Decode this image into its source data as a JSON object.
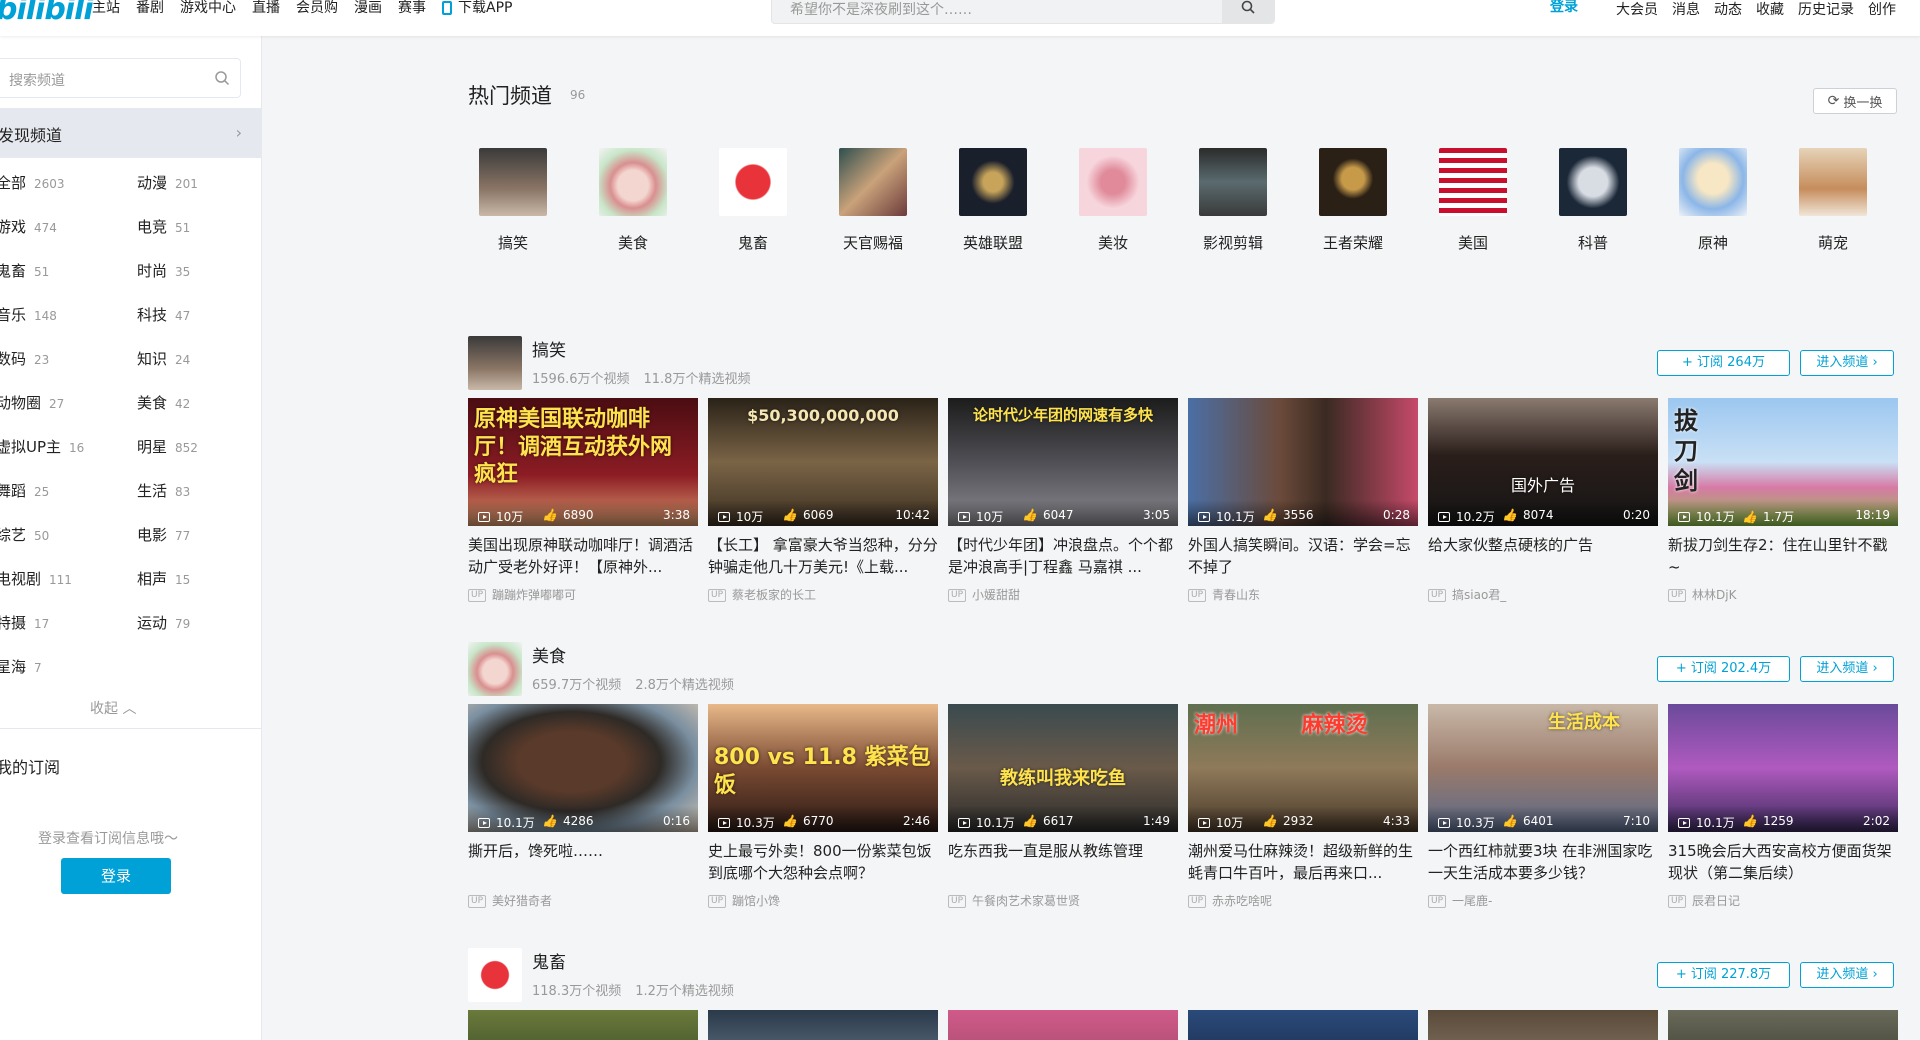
{
  "topbar": {
    "logo": "bilibili",
    "nav": [
      "主站",
      "番剧",
      "游戏中心",
      "直播",
      "会员购",
      "漫画",
      "赛事",
      "下载APP"
    ],
    "search_placeholder": "希望你不是深夜刷到这个……",
    "login": "登录",
    "right_nav": [
      "大会员",
      "消息",
      "动态",
      "收藏",
      "历史记录",
      "创作"
    ]
  },
  "sidebar": {
    "search_placeholder": "搜索频道",
    "discover": "发现频道",
    "categories": [
      {
        "name": "全部",
        "count": "2603"
      },
      {
        "name": "动漫",
        "count": "201"
      },
      {
        "name": "游戏",
        "count": "474"
      },
      {
        "name": "电竞",
        "count": "51"
      },
      {
        "name": "鬼畜",
        "count": "51"
      },
      {
        "name": "时尚",
        "count": "35"
      },
      {
        "name": "音乐",
        "count": "148"
      },
      {
        "name": "科技",
        "count": "47"
      },
      {
        "name": "数码",
        "count": "23"
      },
      {
        "name": "知识",
        "count": "24"
      },
      {
        "name": "动物圈",
        "count": "27"
      },
      {
        "name": "美食",
        "count": "42"
      },
      {
        "name": "虚拟UP主",
        "count": "16"
      },
      {
        "name": "明星",
        "count": "852"
      },
      {
        "name": "舞蹈",
        "count": "25"
      },
      {
        "name": "生活",
        "count": "83"
      },
      {
        "name": "综艺",
        "count": "50"
      },
      {
        "name": "电影",
        "count": "77"
      },
      {
        "name": "电视剧",
        "count": "111"
      },
      {
        "name": "相声",
        "count": "15"
      },
      {
        "name": "特摄",
        "count": "17"
      },
      {
        "name": "运动",
        "count": "79"
      },
      {
        "name": "星海",
        "count": "7"
      }
    ],
    "collapse": "收起",
    "my_sub": "我的订阅",
    "login_tip": "登录查看订阅信息哦～",
    "login_btn": "登录"
  },
  "hot": {
    "title": "热门频道",
    "count": "96",
    "refresh": "换一换",
    "channels": [
      "搞笑",
      "美食",
      "鬼畜",
      "天官赐福",
      "英雄联盟",
      "美妆",
      "影视剪辑",
      "王者荣耀",
      "美国",
      "科普",
      "原神",
      "萌宠"
    ]
  },
  "sections": [
    {
      "name": "搞笑",
      "videos_count": "1596.6万个视频",
      "featured_count": "11.8万个精选视频",
      "subscribe": "+ 订阅 264万",
      "enter": "进入频道",
      "videos": [
        {
          "thumb_text": "原神美国联动咖啡厅！调酒互动获外网疯狂",
          "views": "10万",
          "likes": "6890",
          "duration": "3:38",
          "title": "美国出现原神联动咖啡厅！调酒活动广受老外好评！【原神外...",
          "up": "蹦蹦炸弹嘟嘟可"
        },
        {
          "thumb_text": "$50,300,000,000",
          "views": "10万",
          "likes": "6069",
          "duration": "10:42",
          "title": "【长工】 拿富豪大爷当怨种，分分钟骗走他几十万美元!《上载...",
          "up": "蔡老板家的长工"
        },
        {
          "thumb_text": "论时代少年团的网速有多快",
          "views": "10万",
          "likes": "6047",
          "duration": "3:05",
          "title": "【时代少年团】冲浪盘点。个个都是冲浪高手|丁程鑫 马嘉祺 ...",
          "up": "小媛甜甜"
        },
        {
          "thumb_text": "",
          "views": "10.1万",
          "likes": "3556",
          "duration": "0:28",
          "title": "外国人搞笑瞬间。汉语：学会=忘不掉了",
          "up": "青春山东"
        },
        {
          "thumb_text": "国外广告",
          "views": "10.2万",
          "likes": "8074",
          "duration": "0:20",
          "title": "给大家伙整点硬核的广告",
          "up": "搞siao君_"
        },
        {
          "thumb_text": "拔刀剑",
          "views": "10.1万",
          "likes": "1.7万",
          "duration": "18:19",
          "title": "新拔刀剑生存2：住在山里针不戳~",
          "up": "林林DjK"
        }
      ]
    },
    {
      "name": "美食",
      "videos_count": "659.7万个视频",
      "featured_count": "2.8万个精选视频",
      "subscribe": "+ 订阅 202.4万",
      "enter": "进入频道",
      "videos": [
        {
          "thumb_text": "",
          "views": "10.1万",
          "likes": "4286",
          "duration": "0:16",
          "title": "撕开后，馋死啦……",
          "up": "美好猎奇者"
        },
        {
          "thumb_text": "800 vs 11.8 紫菜包饭",
          "views": "10.3万",
          "likes": "6770",
          "duration": "2:46",
          "title": "史上最亏外卖！800一份紫菜包饭到底哪个大怨种会点啊？",
          "up": "蹦馆小馋"
        },
        {
          "thumb_text": "教练叫我来吃鱼",
          "views": "10.1万",
          "likes": "6617",
          "duration": "1:49",
          "title": "吃东西我一直是服从教练管理",
          "up": "午餐肉艺术家葛世贤"
        },
        {
          "thumb_text": "潮州 麻辣烫",
          "views": "10万",
          "likes": "2932",
          "duration": "4:33",
          "title": "潮州爱马仕麻辣烫！超级新鲜的生蚝青口牛百叶，最后再来口...",
          "up": "赤赤吃啥呢"
        },
        {
          "thumb_text": "生活成本",
          "views": "10.3万",
          "likes": "6401",
          "duration": "7:10",
          "title": "一个西红柿就要3块 在非洲国家吃一天生活成本要多少钱？",
          "up": "一尾鹿-"
        },
        {
          "thumb_text": "",
          "views": "10.1万",
          "likes": "1259",
          "duration": "2:02",
          "title": "315晚会后大西安高校方便面货架现状（第二集后续）",
          "up": "辰君日记"
        }
      ]
    },
    {
      "name": "鬼畜",
      "videos_count": "118.3万个视频",
      "featured_count": "1.2万个精选视频",
      "subscribe": "+ 订阅 227.8万",
      "enter": "进入频道",
      "videos": []
    }
  ]
}
